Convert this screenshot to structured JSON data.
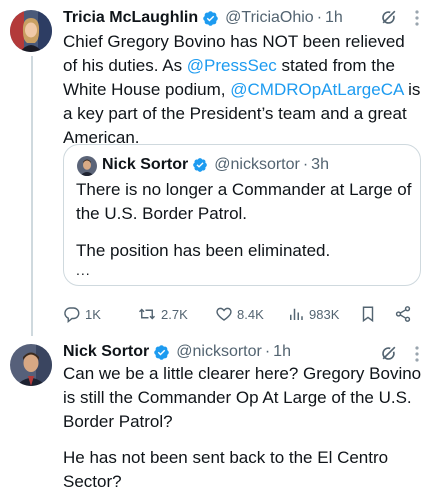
{
  "tweet1": {
    "name": "Tricia McLaughlin",
    "handle": "@TriciaOhio",
    "separator": "·",
    "time": "1h",
    "text_parts": [
      "Chief Gregory Bovino has NOT been relieved of his duties. As ",
      "@PressSec",
      " stated from the White House podium, ",
      "@CMDROpAtLargeCA",
      " is a key part of the President’s team and a great American."
    ]
  },
  "quote": {
    "name": "Nick Sortor",
    "handle": "@nicksortor",
    "separator": "·",
    "time": "3h",
    "line1": "There is no longer a Commander at Large of the U.S. Border Patrol.",
    "line2": "The position has been eliminated.",
    "more": "..."
  },
  "actions": {
    "replies": "1K",
    "reposts": "2.7K",
    "likes": "8.4K",
    "views": "983K"
  },
  "tweet2": {
    "name": "Nick Sortor",
    "handle": "@nicksortor",
    "separator": "·",
    "time": "1h",
    "para1": "Can we be a little clearer here? Gregory Bovino is still the Commander Op At Large of the U.S. Border Patrol?",
    "para2": "He has not been sent back to the El Centro Sector?"
  },
  "colors": {
    "link": "#1d9bf0",
    "secondary_text": "#536471",
    "border": "#cfd9de",
    "verified": "#1d9bf0"
  },
  "icons": [
    "verified-badge-icon",
    "grok-icon",
    "more-icon",
    "reply-icon",
    "repost-icon",
    "like-icon",
    "views-icon",
    "bookmark-icon",
    "share-icon"
  ]
}
